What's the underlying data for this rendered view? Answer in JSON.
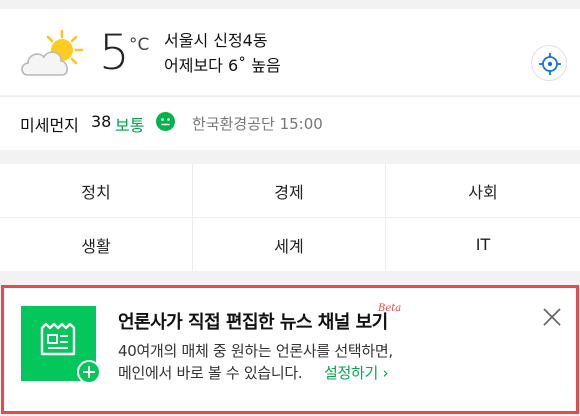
{
  "weather": {
    "icon": "partly-cloudy-sun-icon",
    "temperature": "5",
    "unit": "°C",
    "location": "서울시 신정4동",
    "comparison": "어제보다 6˚ 높음",
    "gps_icon": "crosshair-location-icon"
  },
  "air": {
    "label": "미세먼지",
    "value": "38",
    "status": "보통",
    "status_color": "#00a34a",
    "face_icon": "neutral-face-icon",
    "source": "한국환경공단 15:00"
  },
  "categories": [
    "정치",
    "경제",
    "사회",
    "생활",
    "세계",
    "IT"
  ],
  "promo": {
    "title": "언론사가 직접 편집한 뉴스 채널 보기",
    "badge": "Beta",
    "desc_line1": "40여개의 매체 중 원하는 언론사를 선택하면,",
    "desc_line2": "메인에서 바로 볼 수 있습니다.",
    "link": "설정하기 ›",
    "accent": "#03c75a",
    "border_color": "#e64b4b"
  }
}
